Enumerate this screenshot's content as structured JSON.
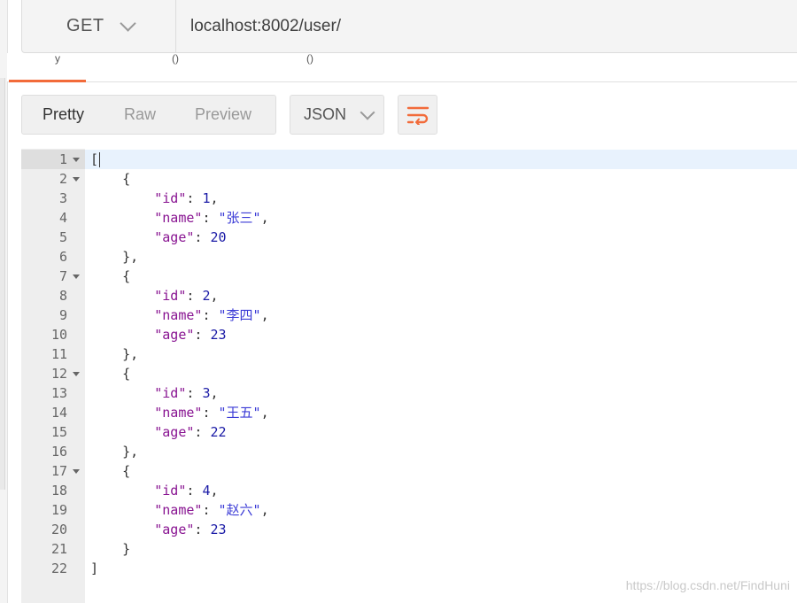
{
  "request": {
    "method": "GET",
    "url": "localhost:8002/user/"
  },
  "response_toolbar": {
    "view_modes": [
      "Pretty",
      "Raw",
      "Preview"
    ],
    "active_view_mode": "Pretty",
    "format": "JSON",
    "wrap_icon": "wrap-lines-icon"
  },
  "colors": {
    "accent": "#f26b3a",
    "json_key": "#881391",
    "json_number": "#1a1aa6",
    "json_string": "#3b3bd6",
    "active_line": "#e8f2fd"
  },
  "code": {
    "lines": [
      {
        "n": "1",
        "fold": true
      },
      {
        "n": "2",
        "fold": true
      },
      {
        "n": "3"
      },
      {
        "n": "4"
      },
      {
        "n": "5"
      },
      {
        "n": "6"
      },
      {
        "n": "7",
        "fold": true
      },
      {
        "n": "8"
      },
      {
        "n": "9"
      },
      {
        "n": "10"
      },
      {
        "n": "11"
      },
      {
        "n": "12",
        "fold": true
      },
      {
        "n": "13"
      },
      {
        "n": "14"
      },
      {
        "n": "15"
      },
      {
        "n": "16"
      },
      {
        "n": "17",
        "fold": true
      },
      {
        "n": "18"
      },
      {
        "n": "19"
      },
      {
        "n": "20"
      },
      {
        "n": "21"
      },
      {
        "n": "22"
      }
    ],
    "users": [
      {
        "id": "1",
        "name": "张三",
        "age": "20"
      },
      {
        "id": "2",
        "name": "李四",
        "age": "23"
      },
      {
        "id": "3",
        "name": "王五",
        "age": "22"
      },
      {
        "id": "4",
        "name": "赵六",
        "age": "23"
      }
    ],
    "tokens": {
      "open_bracket": "[",
      "close_bracket": "]",
      "open_brace": "{",
      "close_brace_comma": "},",
      "close_brace": "}",
      "key_id": "\"id\"",
      "key_name": "\"name\"",
      "key_age": "\"age\"",
      "colon": ": ",
      "comma": ","
    }
  },
  "watermark": "https://blog.csdn.net/FindHuni"
}
